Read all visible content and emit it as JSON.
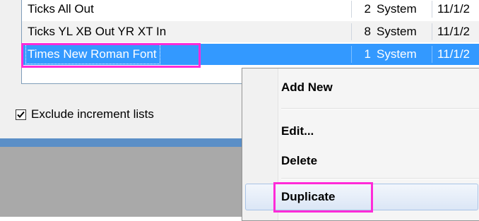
{
  "list": {
    "rows": [
      {
        "name": "Ticks All Out",
        "count": "2",
        "type": "System",
        "date": "11/1/2"
      },
      {
        "name": "Ticks YL XB Out YR XT In",
        "count": "8",
        "type": "System",
        "date": "11/1/2"
      },
      {
        "name": "Times New Roman Font",
        "count": "1",
        "type": "System",
        "date": "11/1/2"
      }
    ]
  },
  "options": {
    "exclude_increment_lists": {
      "label": "Exclude increment lists",
      "checked": true
    }
  },
  "context_menu": {
    "items": [
      "Add New",
      "Edit...",
      "Delete",
      "Duplicate"
    ]
  },
  "colors": {
    "selection": "#3399ff",
    "highlight_annotation": "#ff2bd8"
  }
}
